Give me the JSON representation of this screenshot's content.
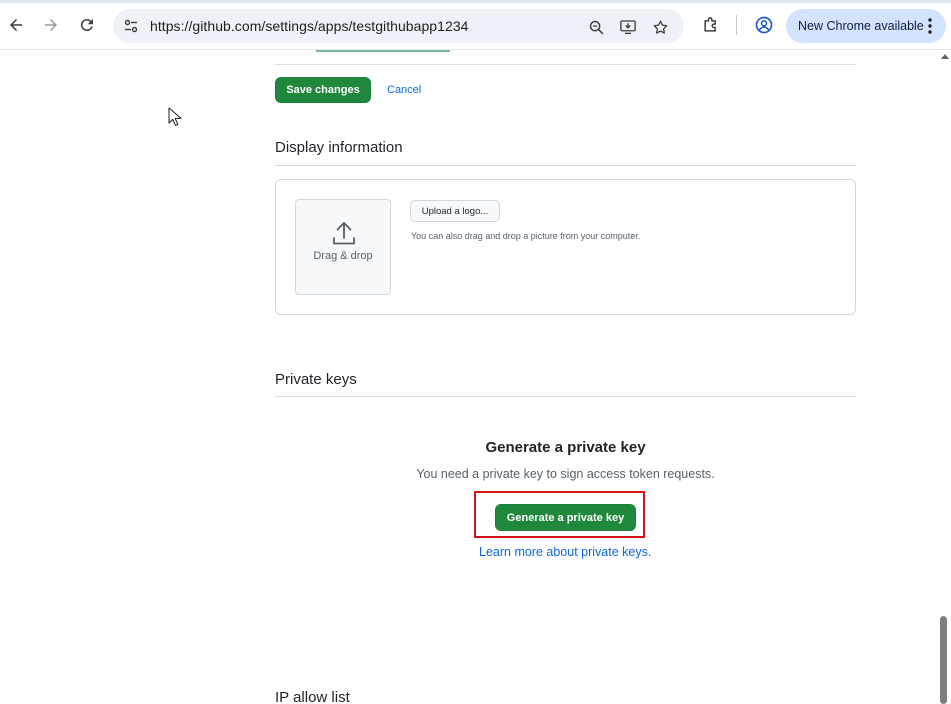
{
  "browser": {
    "url": "https://github.com/settings/apps/testgithubapp1234",
    "update_label": "New Chrome available",
    "icons": {
      "back": "arrow-left-icon",
      "forward": "arrow-right-icon",
      "reload": "reload-icon",
      "site_info": "tune-icon",
      "zoom": "zoom-icon",
      "install": "install-app-icon",
      "bookmark": "star-icon",
      "extensions": "puzzle-icon",
      "profile": "profile-icon",
      "menu": "more-vertical-icon"
    }
  },
  "form_actions": {
    "save_label": "Save changes",
    "cancel_label": "Cancel"
  },
  "display_info": {
    "heading": "Display information",
    "drop_label": "Drag & drop",
    "upload_label": "Upload a logo...",
    "upload_note": "You can also drag and drop a picture from your computer."
  },
  "private_keys": {
    "heading": "Private keys",
    "title": "Generate a private key",
    "description": "You need a private key to sign access token requests.",
    "button_label": "Generate a private key",
    "learn_more": "Learn more about private keys."
  },
  "ip_allow_list": {
    "heading": "IP allow list"
  },
  "colors": {
    "primary_green": "#1f883d",
    "link_blue": "#0969da",
    "highlight_red": "#d0121b",
    "chrome_pill": "#d3e3fd"
  }
}
